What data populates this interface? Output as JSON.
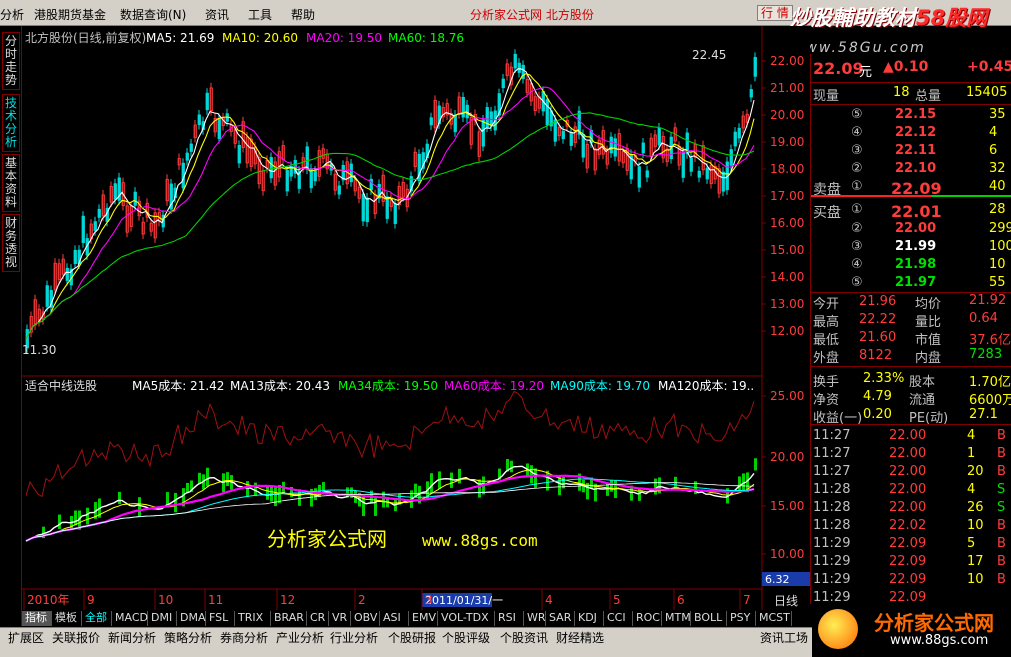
{
  "menu": {
    "items": [
      "分析",
      "港股期货基金",
      "数据查询(N)",
      "资讯",
      "工具",
      "帮助"
    ],
    "center_title": "分析家公式网 北方股份",
    "right_button": "行 情"
  },
  "banner": {
    "prefix": "炒股輔助教材",
    "suffix": "58股网",
    "url": "www.58Gu.com"
  },
  "left_tabs": [
    "分时走势",
    "技术分析",
    "基本资料",
    "财务透视"
  ],
  "main_chart": {
    "legend_title": "北方股份(日线,前复权)",
    "ma": [
      {
        "label": "MA5: 21.69",
        "color": "#ffffff"
      },
      {
        "label": "MA10: 20.60",
        "color": "#ffff00"
      },
      {
        "label": "MA20: 19.50",
        "color": "#ff00ff"
      },
      {
        "label": "MA60: 18.76",
        "color": "#00ff00"
      }
    ],
    "price_ticks": [
      "22.00",
      "21.00",
      "20.00",
      "19.00",
      "18.00",
      "17.00",
      "16.00",
      "15.00",
      "14.00",
      "13.00",
      "12.00"
    ],
    "high_label": "22.45",
    "low_label": "11.30"
  },
  "indicator": {
    "title": "适合中线选股",
    "legend": [
      {
        "label": "MA5成本: 21.42",
        "color": "#ffffff"
      },
      {
        "label": "MA13成本: 20.43",
        "color": "#ffffff"
      },
      {
        "label": "MA34成本: 19.50",
        "color": "#00ff00"
      },
      {
        "label": "MA60成本: 19.20",
        "color": "#ff00ff"
      },
      {
        "label": "MA90成本: 19.70",
        "color": "#00ffff"
      },
      {
        "label": "MA120成本: 19..",
        "color": "#ffffff"
      }
    ],
    "ticks": [
      "25.00",
      "20.00",
      "15.00",
      "10.00"
    ],
    "watermark_cn": "分析家公式网",
    "watermark_url": "www.88gs.com",
    "last_value": "6.32"
  },
  "xaxis": {
    "labels": [
      "2010年",
      "9",
      "10",
      "11",
      "12",
      "2",
      "3",
      "4",
      "5",
      "6",
      "7"
    ],
    "date_box": "2011/01/31/一",
    "period": "日线"
  },
  "quote": {
    "price": "22.09",
    "unit": "元",
    "change": "▲0.10",
    "change_pct": "+0.45",
    "now_label": "现量",
    "now_val": "18",
    "total_label": "总量",
    "total_val": "15405",
    "asks": [
      {
        "n": "⑤",
        "p": "22.15",
        "v": "35"
      },
      {
        "n": "④",
        "p": "22.12",
        "v": "4"
      },
      {
        "n": "③",
        "p": "22.11",
        "v": "6"
      },
      {
        "n": "②",
        "p": "22.10",
        "v": "32"
      }
    ],
    "ask1": {
      "label": "卖盘",
      "n": "①",
      "p": "22.09",
      "v": "40"
    },
    "bid1": {
      "label": "买盘",
      "n": "①",
      "p": "22.01",
      "v": "28"
    },
    "bids": [
      {
        "n": "②",
        "p": "22.00",
        "v": "299"
      },
      {
        "n": "③",
        "p": "21.99",
        "v": "100"
      },
      {
        "n": "④",
        "p": "21.98",
        "v": "10"
      },
      {
        "n": "⑤",
        "p": "21.97",
        "v": "55"
      }
    ],
    "stats": [
      {
        "l1": "今开",
        "v1": "21.96",
        "l2": "均价",
        "v2": "21.92"
      },
      {
        "l1": "最高",
        "v1": "22.22",
        "l2": "量比",
        "v2": "0.64"
      },
      {
        "l1": "最低",
        "v1": "21.60",
        "l2": "市值",
        "v2": "37.6亿"
      },
      {
        "l1": "外盘",
        "v1": "8122",
        "l2": "内盘",
        "v2": "7283"
      }
    ],
    "fin": [
      {
        "l1": "换手",
        "v1": "2.33%",
        "l2": "股本",
        "v2": "1.70亿"
      },
      {
        "l1": "净资",
        "v1": "4.79",
        "l2": "流通",
        "v2": "6600万"
      },
      {
        "l1": "收益(一)",
        "v1": "0.20",
        "l2": "PE(动)",
        "v2": "27.1"
      }
    ],
    "ticks": [
      {
        "t": "11:27",
        "p": "22.00",
        "v": "4",
        "d": "B"
      },
      {
        "t": "11:27",
        "p": "22.00",
        "v": "1",
        "d": "B"
      },
      {
        "t": "11:27",
        "p": "22.00",
        "v": "20",
        "d": "B"
      },
      {
        "t": "11:28",
        "p": "22.00",
        "v": "4",
        "d": "S"
      },
      {
        "t": "11:28",
        "p": "22.00",
        "v": "26",
        "d": "S"
      },
      {
        "t": "11:28",
        "p": "22.02",
        "v": "10",
        "d": "B"
      },
      {
        "t": "11:29",
        "p": "22.09",
        "v": "5",
        "d": "B"
      },
      {
        "t": "11:29",
        "p": "22.09",
        "v": "17",
        "d": "B"
      },
      {
        "t": "11:29",
        "p": "22.09",
        "v": "10",
        "d": "B"
      },
      {
        "t": "11:29",
        "p": "22.09",
        "v": "",
        "d": ""
      }
    ]
  },
  "bottom_tabs": [
    "指标",
    "模板",
    "全部",
    "MACD",
    "DMI",
    "DMA",
    "FSL",
    "TRIX",
    "BRAR",
    "CR",
    "VR",
    "OBV",
    "ASI",
    "EMV",
    "VOL-TDX",
    "RSI",
    "WR",
    "SAR",
    "KDJ",
    "CCI",
    "ROC",
    "MTM",
    "BOLL",
    "PSY",
    "MCST"
  ],
  "status_tabs": [
    "扩展区",
    "关联报价",
    "新闻分析",
    "策略分析",
    "券商分析",
    "产业分析",
    "行业分析",
    "个股研报",
    "个股评级",
    "个股资讯",
    "财经精选",
    "资讯工场"
  ],
  "logo": {
    "title": "分析家公式网",
    "url": "www.88gs.com"
  }
}
